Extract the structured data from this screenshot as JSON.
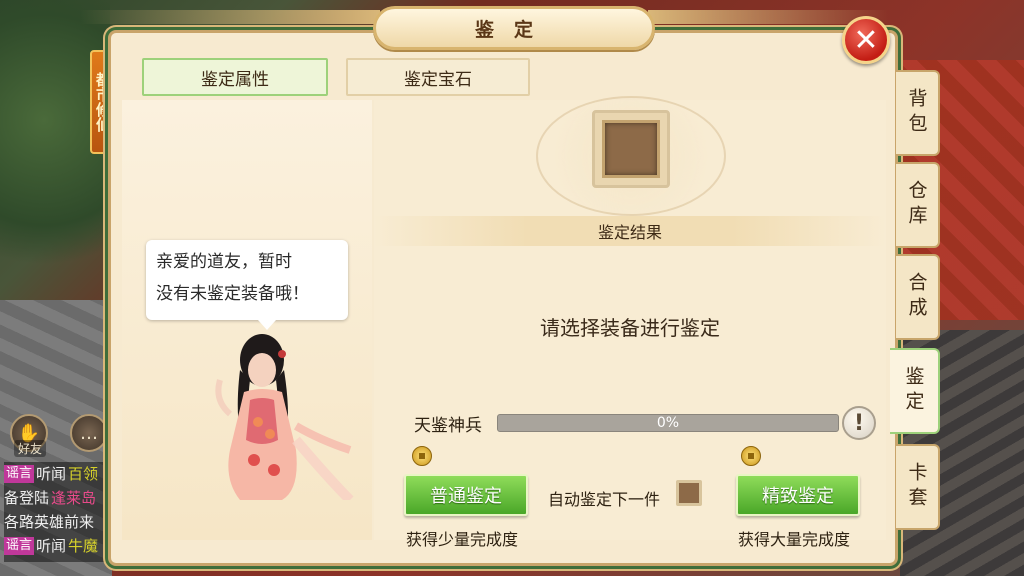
{
  "window": {
    "title": "鉴定",
    "close_icon": "close-x-icon"
  },
  "side_banner": {
    "text": "都市修仙"
  },
  "hud": {
    "friends_label": "好友",
    "chat_icon": "chat-bubble-icon"
  },
  "chat": {
    "lines": [
      {
        "tag": "谣言",
        "text": "听闻",
        "highlight": "百领"
      },
      {
        "tag": "",
        "text": "备登陆",
        "highlight": "逢莱岛"
      },
      {
        "tag": "",
        "text": "各路英雄前来",
        "highlight": ""
      },
      {
        "tag": "谣言",
        "text": "听闻",
        "highlight": "牛魔"
      }
    ]
  },
  "tabs": [
    {
      "label": "鉴定属性",
      "active": true
    },
    {
      "label": "鉴定宝石",
      "active": false
    }
  ],
  "npc": {
    "message_line1": "亲爱的道友，暂时",
    "message_line2": "没有未鉴定装备哦！"
  },
  "identify": {
    "result_title": "鉴定结果",
    "prompt": "请选择装备进行鉴定",
    "progress_label": "天鉴神兵",
    "progress_percent": 0,
    "progress_text": "0%",
    "info_icon": "exclamation-icon",
    "normal_button": "普通鉴定",
    "normal_caption": "获得少量完成度",
    "fine_button": "精致鉴定",
    "fine_caption": "获得大量完成度",
    "auto_label": "自动鉴定下一件",
    "auto_checked": false,
    "coin_icon": "coin-icon"
  },
  "side_tabs": [
    {
      "label": "背包",
      "active": false
    },
    {
      "label": "仓库",
      "active": false
    },
    {
      "label": "合成",
      "active": false
    },
    {
      "label": "鉴定",
      "active": true
    },
    {
      "label": "卡套",
      "active": false
    }
  ],
  "colors": {
    "active_green": "#9dd17a",
    "button_green": "#4aa728",
    "close_red": "#c31d14",
    "panel_bg": "#f7ead0"
  }
}
